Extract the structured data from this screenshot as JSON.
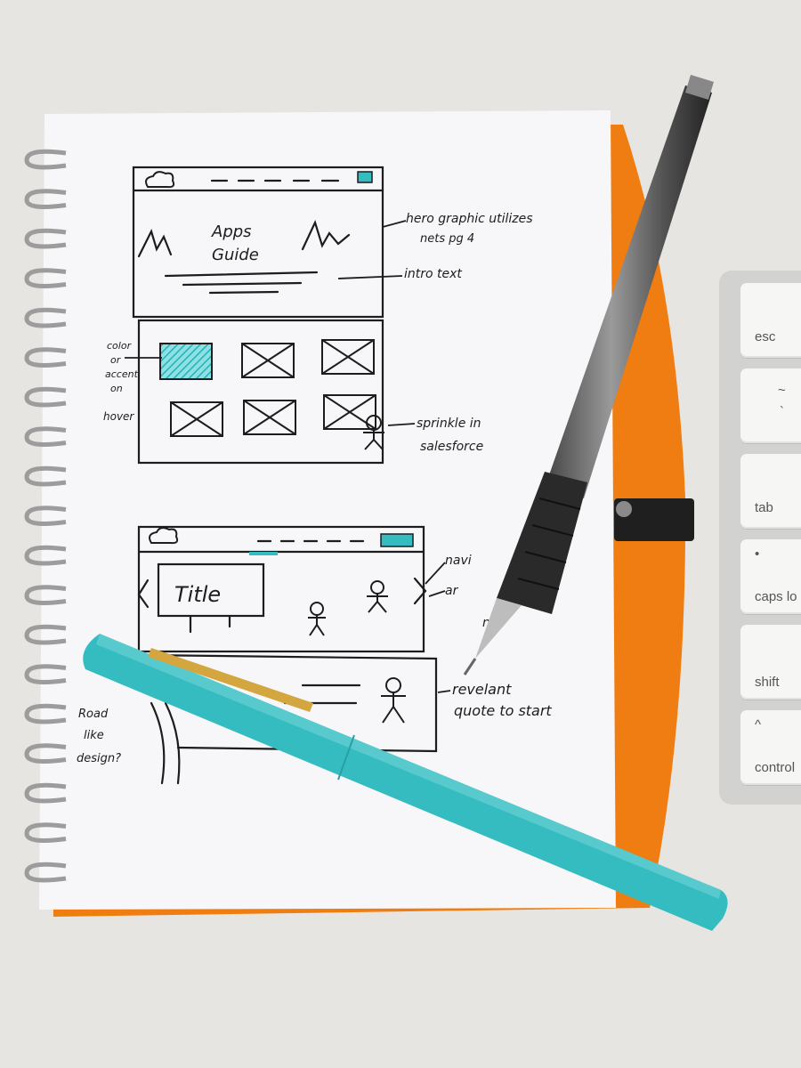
{
  "sketch_top": {
    "hero_title": [
      "Apps",
      "Guide"
    ],
    "notes": [
      [
        "hero graphic utilizes",
        "nets pg 4"
      ],
      [
        "intro text"
      ],
      [
        "color",
        "or",
        "accent",
        "on",
        "hover"
      ],
      [
        "sprinkle in",
        "salesforce"
      ]
    ]
  },
  "sketch_bottom": {
    "title_box": "Title",
    "notes": [
      [
        "navi",
        "ar",
        "n"
      ],
      [
        "revelant",
        "quote to start"
      ],
      [
        "Road",
        "like",
        "design?"
      ]
    ]
  },
  "keyboard": {
    "keys": [
      {
        "top": "",
        "label": "esc"
      },
      {
        "top": "~",
        "label": "`"
      },
      {
        "top": "",
        "label": "tab"
      },
      {
        "top": "•",
        "label": "caps lo"
      },
      {
        "top": "",
        "label": "shift"
      },
      {
        "top": "^",
        "label": "control"
      }
    ]
  },
  "colors": {
    "teal": "#35bcc0",
    "orange": "#f07d12",
    "ink": "#1d1d1d",
    "paper": "#f7f7f9"
  }
}
